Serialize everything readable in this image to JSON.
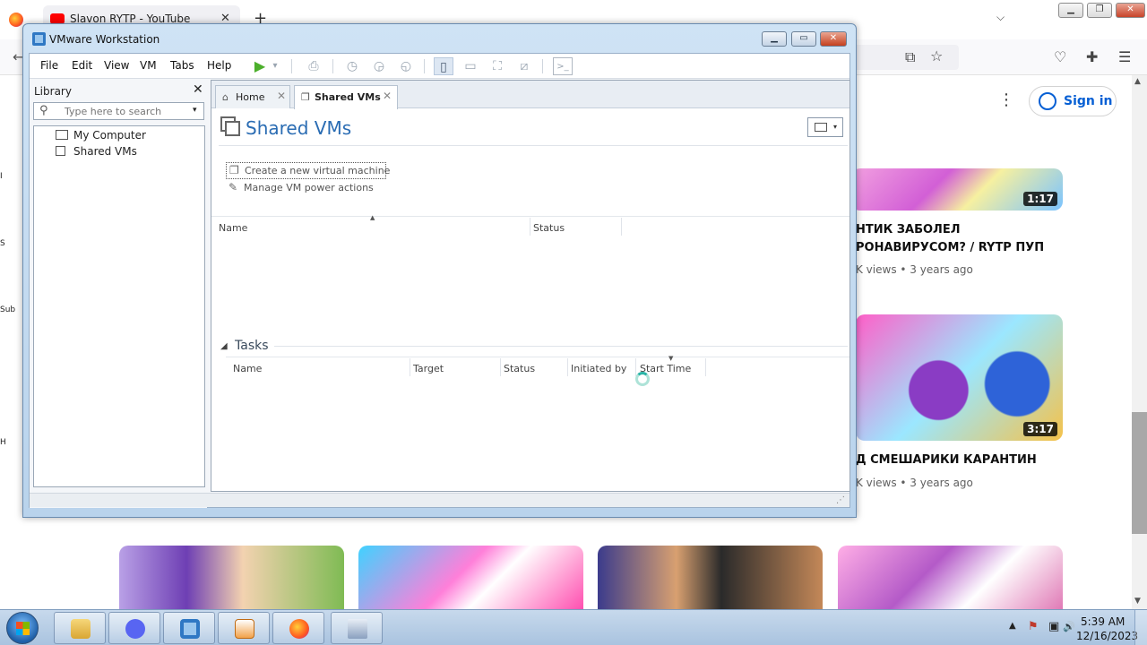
{
  "browser": {
    "tab_title": "Slavon RYTP - YouTube",
    "tab_close": "✕",
    "new_tab": "+",
    "tab_list": "⌵",
    "min": "▁",
    "max": "❐",
    "close": "✕",
    "back": "←"
  },
  "youtube": {
    "signin_label": "Sign in",
    "more": "⋮",
    "sidebar_fragments": [
      "I",
      "S",
      "Sub",
      "H"
    ],
    "videos": [
      {
        "title_line1": "НТИК ЗАБОЛЕЛ",
        "title_line2": "РОНАВИРУСОМ? / RYTP ПУП",
        "meta": "K views • 3 years ago",
        "duration": "1:17"
      },
      {
        "title_line1": "Д СМЕШАРИКИ КАРАНТИН",
        "title_line2": "",
        "meta": "K views • 3 years ago",
        "duration": "3:17"
      }
    ]
  },
  "vmware": {
    "title": "VMware Workstation",
    "min": "▁",
    "max": "▭",
    "close": "✕",
    "menu": [
      "File",
      "Edit",
      "View",
      "VM",
      "Tabs",
      "Help"
    ],
    "toolbar": {
      "play": "▶",
      "dropdown": "▾",
      "send_keys": "⎙",
      "snap_take": "◷",
      "snap_revert": "◶",
      "snap_manager": "◵",
      "view_library": "▯",
      "view_thumbs": "▭",
      "view_fullscreen": "⛶",
      "view_unity": "⧄",
      "console": ">_"
    },
    "library": {
      "title": "Library",
      "close": "✕",
      "search_placeholder": "Type here to search",
      "search_icon": "⚲",
      "dropdown": "▾",
      "items": [
        "My Computer",
        "Shared VMs"
      ]
    },
    "tabs": [
      {
        "label": "Home",
        "icon": "⌂",
        "close": "✕"
      },
      {
        "label": "Shared VMs",
        "icon": "❐",
        "close": "✕"
      }
    ],
    "page": {
      "title": "Shared VMs",
      "view_dropdown": "▾",
      "actions": [
        {
          "label": "Create a new virtual machine",
          "icon": "❐"
        },
        {
          "label": "Manage VM power actions",
          "icon": "✎"
        }
      ],
      "vm_columns": [
        "Name",
        "Status"
      ],
      "sort_indicator": "▲",
      "tasks_title": "Tasks",
      "tasks_toggle": "◢",
      "task_columns": [
        "Name",
        "Target",
        "Status",
        "Initiated by",
        "Start Time"
      ],
      "task_sort_indicator": "▼"
    },
    "grip": "⋰"
  },
  "taskbar": {
    "tray_up": "▲",
    "clock_time": "5:39 AM",
    "clock_date": "12/16/2023",
    "tray_icons": [
      "⚑",
      "▣",
      "🔊"
    ]
  }
}
